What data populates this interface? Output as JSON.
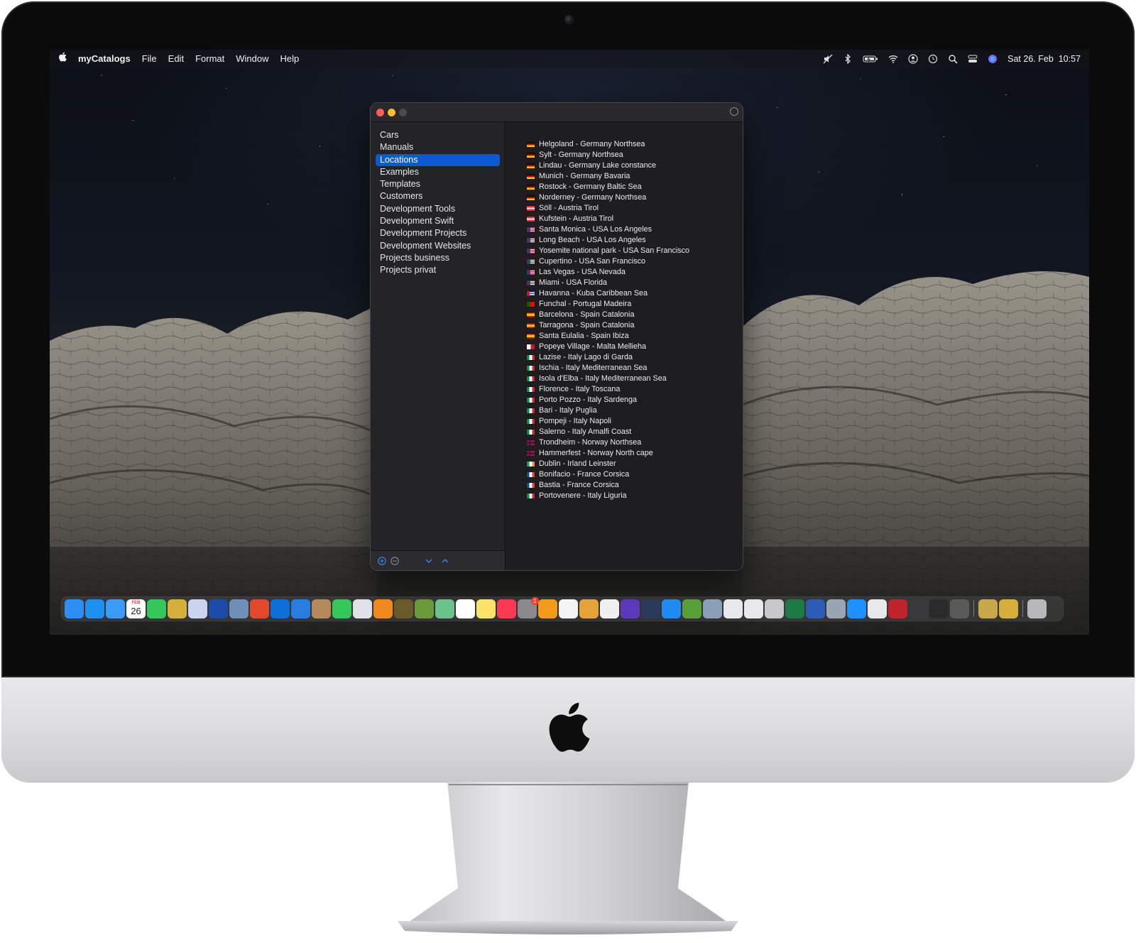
{
  "menubar": {
    "apple_menu": "",
    "app_name": "myCatalogs",
    "menus": [
      "File",
      "Edit",
      "Format",
      "Window",
      "Help"
    ],
    "datetime": "Sat 26. Feb  10:57",
    "status_icons": [
      "audio-muted-icon",
      "bluetooth-icon",
      "battery-charging-icon",
      "wifi-icon",
      "user-icon",
      "time-machine-icon",
      "spotlight-search-icon",
      "control-center-icon",
      "siri-icon"
    ]
  },
  "window": {
    "controls": [
      "close",
      "minimize",
      "zoom"
    ],
    "share_icon": "share-icon",
    "sidebar": {
      "items": [
        {
          "label": "Cars",
          "selected": false
        },
        {
          "label": "Manuals",
          "selected": false
        },
        {
          "label": "Locations",
          "selected": true
        },
        {
          "label": "Examples",
          "selected": false
        },
        {
          "label": "Templates",
          "selected": false
        },
        {
          "label": "Customers",
          "selected": false
        },
        {
          "label": "Development Tools",
          "selected": false
        },
        {
          "label": "Development Swift",
          "selected": false
        },
        {
          "label": "Development Projects",
          "selected": false
        },
        {
          "label": "Development Websites",
          "selected": false
        },
        {
          "label": "Projects business",
          "selected": false
        },
        {
          "label": "Projects privat",
          "selected": false
        }
      ],
      "footer_icons": [
        "add-icon",
        "remove-icon",
        "move-down-icon",
        "move-up-icon"
      ]
    },
    "locations": [
      {
        "flag": "de",
        "label": "Helgoland - Germany Northsea"
      },
      {
        "flag": "de",
        "label": "Sylt - Germany Northsea"
      },
      {
        "flag": "de",
        "label": "Lindau - Germany Lake constance"
      },
      {
        "flag": "de",
        "label": "Munich - Germany Bavaria"
      },
      {
        "flag": "de",
        "label": "Rostock - Germany Baltic Sea"
      },
      {
        "flag": "de",
        "label": "Norderney - Germany Northsea"
      },
      {
        "flag": "at",
        "label": "Söll - Austria Tirol"
      },
      {
        "flag": "at",
        "label": "Kufstein - Austria Tirol"
      },
      {
        "flag": "us",
        "label": "Santa Monica - USA Los Angeles"
      },
      {
        "flag": "us",
        "label": "Long Beach - USA Los Angeles"
      },
      {
        "flag": "us",
        "label": "Yosemite national park - USA San Francisco"
      },
      {
        "flag": "us",
        "label": "Cupertino - USA San Francisco"
      },
      {
        "flag": "us",
        "label": "Las Vegas - USA Nevada"
      },
      {
        "flag": "us",
        "label": "Miami - USA Florida"
      },
      {
        "flag": "cu",
        "label": "Havanna - Kuba Caribbean Sea"
      },
      {
        "flag": "pt",
        "label": "Funchal - Portugal Madeira"
      },
      {
        "flag": "es",
        "label": "Barcelona - Spain Catalonia"
      },
      {
        "flag": "es",
        "label": "Tarragona - Spain Catalonia"
      },
      {
        "flag": "es",
        "label": "Santa Eulalia - Spain Ibiza"
      },
      {
        "flag": "mt",
        "label": "Popeye Village - Malta Mellieha"
      },
      {
        "flag": "it",
        "label": "Lazise - Italy Lago di Garda"
      },
      {
        "flag": "it",
        "label": "Ischia - Italy Mediterranean Sea"
      },
      {
        "flag": "it",
        "label": "Isola d'Elba - Italy Mediterranean Sea"
      },
      {
        "flag": "it",
        "label": "Florence - Italy Toscana"
      },
      {
        "flag": "it",
        "label": "Porto Pozzo - Italy Sardenga"
      },
      {
        "flag": "it",
        "label": "Bari - Italy Puglia"
      },
      {
        "flag": "it",
        "label": "Pompeji - Italy Napoli"
      },
      {
        "flag": "it",
        "label": "Salerno - Italy Amalfi Coast"
      },
      {
        "flag": "no",
        "label": "Trondheim - Norway Northsea"
      },
      {
        "flag": "no",
        "label": "Hammerfest - Norway North cape"
      },
      {
        "flag": "ie",
        "label": "Dublin - Irland Leinster"
      },
      {
        "flag": "fr",
        "label": "Bonifacio - France Corsica"
      },
      {
        "flag": "fr",
        "label": "Bastia - France Corsica"
      },
      {
        "flag": "it",
        "label": "Portovenere - Italy Liguria"
      }
    ]
  },
  "dock": {
    "calendar_day": "26",
    "calendar_month": "FEB",
    "badge_count": "1",
    "apps": [
      {
        "name": "finder-icon",
        "color": "#2f8ef5"
      },
      {
        "name": "safari-icon",
        "color": "#1f8ff0"
      },
      {
        "name": "mail-icon",
        "color": "#3a9cf8"
      },
      {
        "name": "calendar-icon",
        "color": "#ffffff"
      },
      {
        "name": "messages-icon",
        "color": "#34c759"
      },
      {
        "name": "reeder-star-icon",
        "color": "#d4b03a"
      },
      {
        "name": "invoice-icon",
        "color": "#c8d4f0"
      },
      {
        "name": "xcode-blueprint-icon",
        "color": "#1b4aa8"
      },
      {
        "name": "preview-icon",
        "color": "#6d8fb8"
      },
      {
        "name": "remote-desktop-icon",
        "color": "#e04a2a"
      },
      {
        "name": "teamviewer-icon",
        "color": "#0e6fd8"
      },
      {
        "name": "pencil-sketch-icon",
        "color": "#2a7de0"
      },
      {
        "name": "contacts-icon",
        "color": "#b48a5a"
      },
      {
        "name": "facetime-icon",
        "color": "#34c759"
      },
      {
        "name": "system-info-icon",
        "color": "#dfe3e8"
      },
      {
        "name": "sync-icon",
        "color": "#f08a1e"
      },
      {
        "name": "photo-booth-icon",
        "color": "#6a5a2a"
      },
      {
        "name": "android-icon",
        "color": "#6a9a3a"
      },
      {
        "name": "maps-icon",
        "color": "#6cc38a"
      },
      {
        "name": "reminders-icon",
        "color": "#ffffff"
      },
      {
        "name": "notes-icon",
        "color": "#fbe26a"
      },
      {
        "name": "music-icon",
        "color": "#fa3a52"
      },
      {
        "name": "system-preferences-icon",
        "color": "#8a8a8e"
      },
      {
        "name": "books-icon",
        "color": "#f39a1a"
      },
      {
        "name": "photos-icon",
        "color": "#f4f4f4"
      },
      {
        "name": "image-editor-icon",
        "color": "#e6a23a"
      },
      {
        "name": "textedit-icon",
        "color": "#f0f0f0"
      },
      {
        "name": "imovie-icon",
        "color": "#5a3ab8"
      },
      {
        "name": "quicktime-icon",
        "color": "#2a3a5a"
      },
      {
        "name": "app-store-icon",
        "color": "#1e8cf2"
      },
      {
        "name": "landscape-app-icon",
        "color": "#5aa03a"
      },
      {
        "name": "bwc-icon",
        "color": "#8aa0b8"
      },
      {
        "name": "blank-doc-icon",
        "color": "#e8e8ea"
      },
      {
        "name": "blank-app-icon",
        "color": "#e8e8ea"
      },
      {
        "name": "license-icon",
        "color": "#c8c8cc"
      },
      {
        "name": "excel-icon",
        "color": "#1d7a45"
      },
      {
        "name": "word-icon",
        "color": "#2b5cb8"
      },
      {
        "name": "disk-utility-icon",
        "color": "#9aa5b4"
      },
      {
        "name": "airdrop-icon",
        "color": "#1e90ff"
      },
      {
        "name": "generic-app-icon",
        "color": "#e8e8ea"
      },
      {
        "name": "filezilla-icon",
        "color": "#c0232a"
      },
      {
        "name": "scanner-icon",
        "color": "#3a3a3c"
      },
      {
        "name": "inkscape-icon",
        "color": "#2a2a2a"
      },
      {
        "name": "automator-icon",
        "color": "#5a5a5a"
      }
    ],
    "recent_apps": [
      {
        "name": "photo-slideshow-icon",
        "color": "#c9a84a"
      },
      {
        "name": "favorites-star-icon",
        "color": "#d4b03a"
      }
    ],
    "trash": {
      "name": "trash-icon",
      "color": "#b8b8bc"
    }
  },
  "hardware": {
    "logo": "apple-logo-icon",
    "bezel_color": "#0b0b0c",
    "chin_color": "#dcdcdf"
  }
}
